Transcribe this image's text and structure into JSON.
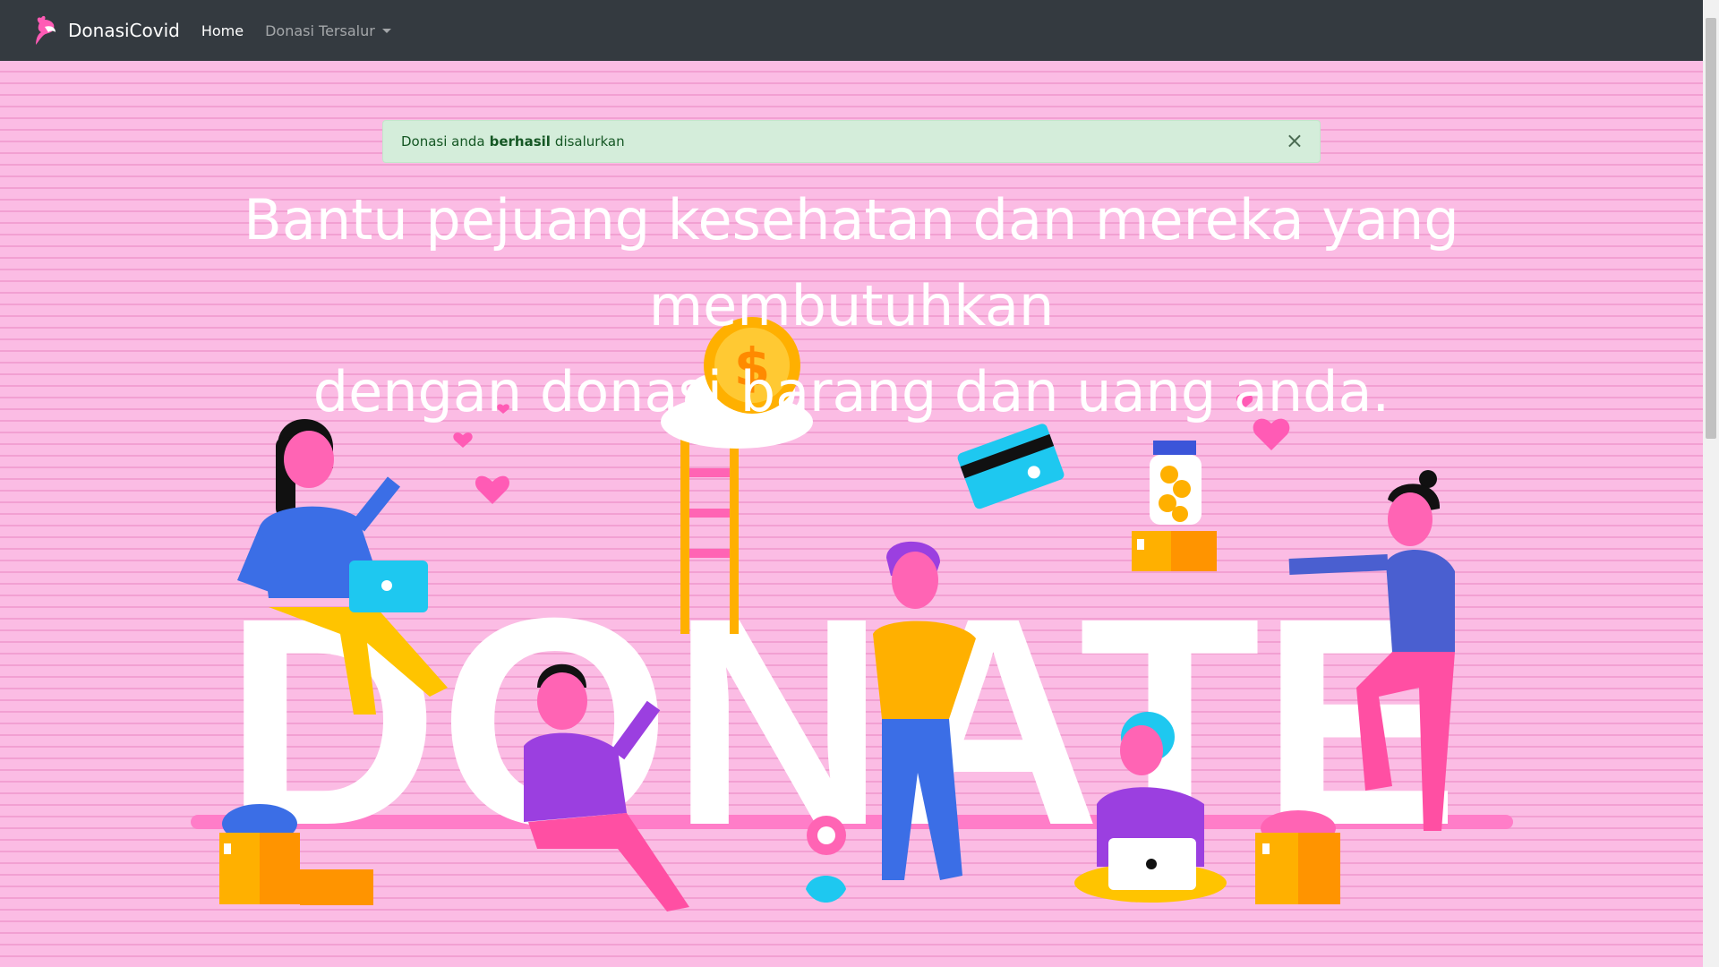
{
  "navbar": {
    "brand": "DonasiCovid",
    "links": [
      {
        "label": "Home"
      },
      {
        "label": "Donasi Tersalur"
      }
    ]
  },
  "alert": {
    "text_before": "Donasi anda",
    "text_bold": "berhasil",
    "text_after": "disalurkan",
    "close": "×"
  },
  "hero": {
    "headline_line1": "Bantu pejuang kesehatan dan mereka yang membutuhkan",
    "headline_line2": "dengan donasi barang dan uang anda.",
    "illustration_word": "DONATE",
    "coin_symbol": "$"
  },
  "colors": {
    "navbar": "#343a40",
    "hero_bg": "#fbbce4",
    "alert_bg": "#d4edda"
  }
}
